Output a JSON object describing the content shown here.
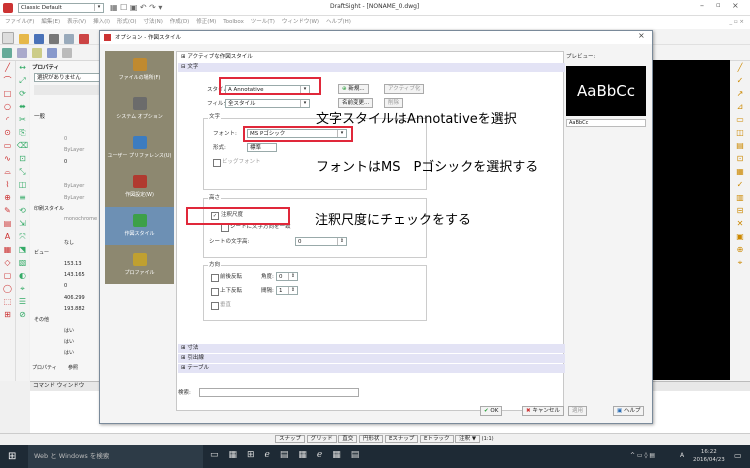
{
  "window": {
    "title": "DraftSight - [NONAME_0.dwg]",
    "workspace": "Classic Default",
    "menu": [
      "ファイル(F)",
      "編集(E)",
      "表示(V)",
      "挿入(I)",
      "形式(O)",
      "寸法(N)",
      "作成(D)",
      "修正(M)",
      "Toolbox",
      "ツール(T)",
      "ウィンドウ(W)",
      "ヘルプ(H)"
    ]
  },
  "left_panel": {
    "title": "プロパティ",
    "no_selection": "選択がありません",
    "general": "一般",
    "bylayer": "ByLayer",
    "value_0": "0",
    "print_style": "印刷スタイル",
    "color_name": "monochrome",
    "none": "なし",
    "view": "ビュー",
    "coords": [
      "153.13",
      "143.165",
      "0",
      "406.299",
      "193.882"
    ],
    "other": "その他",
    "yes1": "はい",
    "yes2": "はい",
    "yes3": "はい",
    "tabs": [
      "プロパティ",
      "参照"
    ]
  },
  "dialog": {
    "title": "オプション - 作図スタイル",
    "nav": [
      {
        "label": "ファイルの場所(F)",
        "icon": "folder-icon",
        "color": "#c08a30"
      },
      {
        "label": "システム オプション",
        "icon": "pc-icon",
        "color": "#6b6b6b"
      },
      {
        "label": "ユーザー プリファレンス(U)",
        "icon": "user-gear-icon",
        "color": "#3c7cc0"
      },
      {
        "label": "作図設定(W)",
        "icon": "drafting-icon",
        "color": "#b03a30"
      },
      {
        "label": "作図スタイル",
        "icon": "style-icon",
        "color": "#3da048"
      },
      {
        "label": "プロファイル",
        "icon": "profile-icon",
        "color": "#c0a030"
      }
    ],
    "sections": {
      "active": "アクティブな作図スタイル",
      "text": "文字",
      "dimension": "寸法",
      "leader": "引出線",
      "table": "テーブル"
    },
    "style_label": "スタイル:",
    "style_value": "A Annotative",
    "filter_label": "フィルタ:",
    "filter_value": "全スタイル",
    "new_btn": "新規...",
    "activate_btn": "アクティブ化",
    "rename_btn": "名前変更...",
    "delete_btn": "削除",
    "text_group": "文字",
    "font_label": "フォント:",
    "font_value": "MS Pゴシック",
    "format_label": "形式:",
    "format_value": "標準",
    "bigfont_label": "ビッグフォント",
    "height_group": "高さ",
    "annotative_label": "注釈尺度",
    "match_label": "シートに文字方向を一致",
    "sheet_height_label": "シートの文字高:",
    "sheet_height_value": "0",
    "direction_group": "方向",
    "backward_label": "前後反転",
    "angle_label": "角度:",
    "angle_value": "0",
    "upside_label": "上下反転",
    "spacing_label": "間隔:",
    "spacing_value": "1",
    "vertical_label": "垂直",
    "search_label": "検索:",
    "ok_btn": "OK",
    "cancel_btn": "キャンセル",
    "apply_btn": "適用",
    "help_btn": "ヘルプ",
    "preview_label": "プレビュー:",
    "preview_text": "AaBbCc",
    "preview_input": "AaBbCc"
  },
  "annotations": {
    "style": "文字スタイルはAnnotativeを選択",
    "font": "フォントはMS　Pゴシックを選択する",
    "scale": "注釈尺度にチェックをする"
  },
  "command_window": {
    "title": "コマンド ウィンドウ"
  },
  "status_bar": [
    "スナップ",
    "グリッド",
    "直交",
    "円形状",
    "Eスナップ",
    "Eトラック",
    "注釈 ▼",
    "(1:1)"
  ],
  "taskbar": {
    "search": "Web と Windows を検索",
    "time": "16:22",
    "date": "2016/04/23",
    "ime": "A"
  }
}
